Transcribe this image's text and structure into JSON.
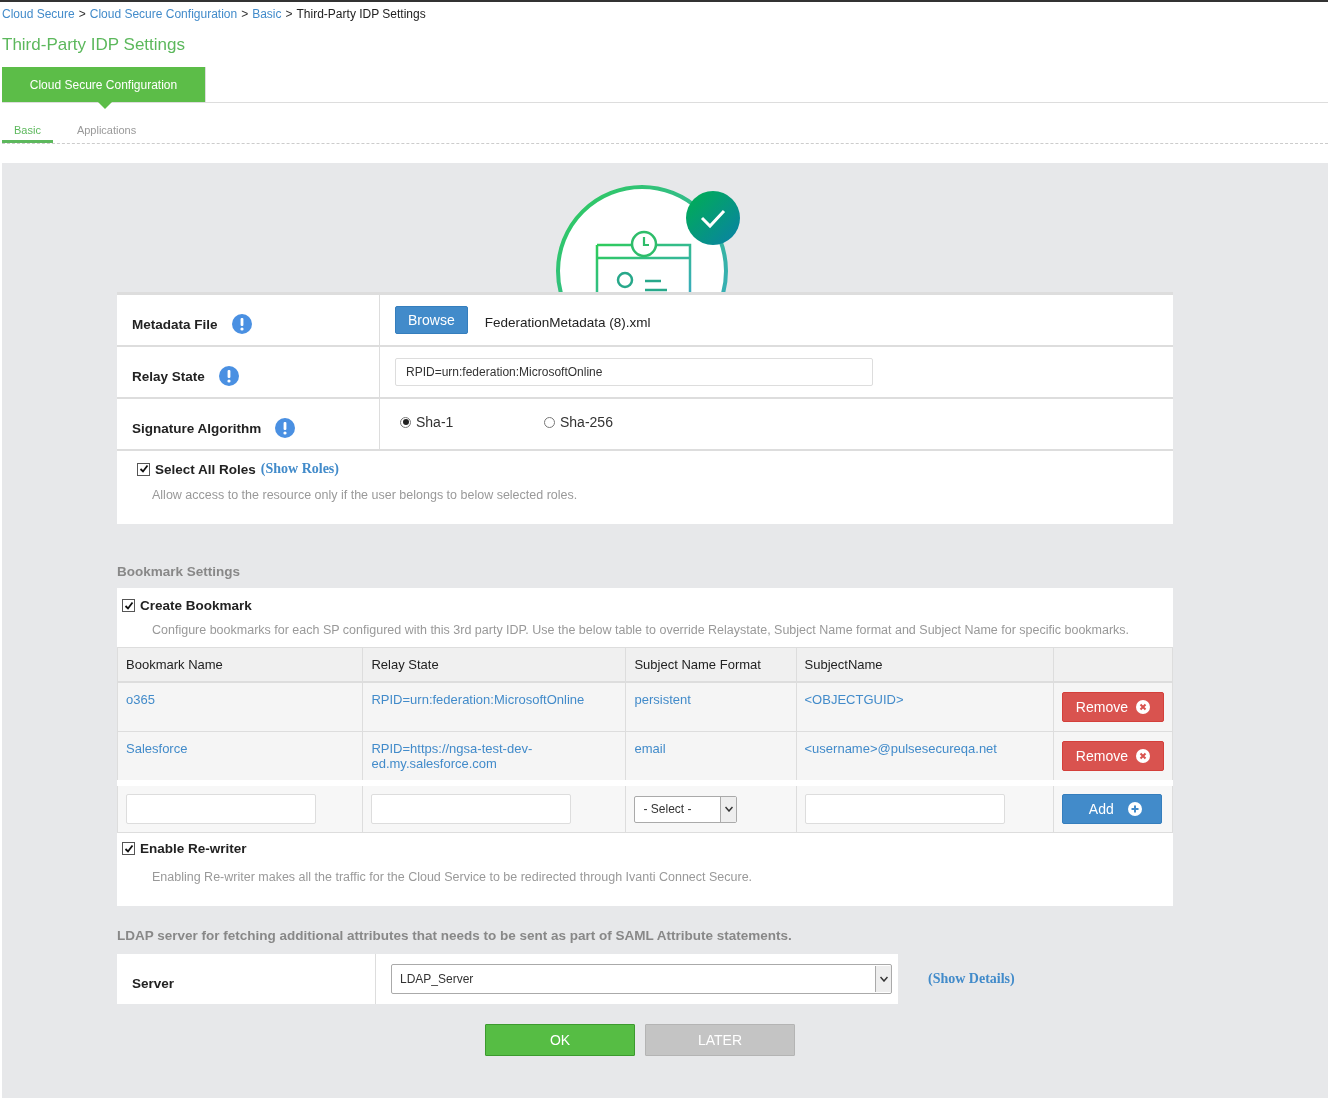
{
  "breadcrumb": [
    {
      "label": "Cloud Secure",
      "kind": "link"
    },
    {
      "label": "Cloud Secure Configuration",
      "kind": "link"
    },
    {
      "label": "Basic",
      "kind": "link"
    },
    {
      "label": "Third-Party IDP Settings",
      "kind": "current"
    }
  ],
  "breadcrumb_separator": ">",
  "title": "Third-Party IDP Settings",
  "tabs": [
    {
      "label": "Cloud Secure Configuration",
      "selected": true
    }
  ],
  "subtabs": [
    {
      "label": "Basic",
      "selected": true
    },
    {
      "label": "Applications",
      "selected": false
    }
  ],
  "form": {
    "metadata_file": {
      "label": "Metadata File",
      "button": "Browse",
      "filename": "FederationMetadata (8).xml"
    },
    "relay_state": {
      "label": "Relay State",
      "value": "RPID=urn:federation:MicrosoftOnline"
    },
    "signature_algorithm": {
      "label": "Signature Algorithm",
      "options": [
        {
          "label": "Sha-1",
          "selected": true
        },
        {
          "label": "Sha-256",
          "selected": false
        }
      ]
    },
    "roles": {
      "label": "Select All Roles",
      "checked": true,
      "link": "(Show Roles)",
      "description": "Allow access to the resource only if the user belongs to below selected roles."
    }
  },
  "bookmark_settings": {
    "heading": "Bookmark Settings",
    "create": {
      "label": "Create Bookmark",
      "checked": true,
      "description": "Configure bookmarks for each SP configured with this 3rd party IDP. Use the below table to override Relaystate, Subject Name format and Subject Name for specific bookmarks."
    },
    "table": {
      "columns": [
        "Bookmark Name",
        "Relay State",
        "Subject Name Format",
        "SubjectName"
      ],
      "rows": [
        {
          "cells": [
            "o365",
            "RPID=urn:federation:MicrosoftOnline",
            "persistent",
            "<OBJECTGUID>"
          ],
          "action": "Remove"
        },
        {
          "cells": [
            "Salesforce",
            "RPID=https://ngsa-test-dev-ed.my.salesforce.com",
            "email",
            "<username>@pulsesecureqa.net"
          ],
          "action": "Remove"
        }
      ],
      "new_row": {
        "select": "- Select -",
        "button": "Add"
      }
    },
    "rewriter": {
      "label": "Enable Re-writer",
      "checked": true,
      "description": "Enabling Re-writer makes all the traffic for the Cloud Service to be redirected through Ivanti Connect Secure."
    }
  },
  "ldap": {
    "heading": "LDAP server for fetching additional attributes that needs to be sent as part of SAML Attribute statements.",
    "server": {
      "label": "Server",
      "value": "LDAP_Server"
    },
    "link": "(Show Details)"
  },
  "buttons": [
    {
      "label": "OK",
      "kind": "primary"
    },
    {
      "label": "LATER",
      "kind": "disabled"
    }
  ]
}
